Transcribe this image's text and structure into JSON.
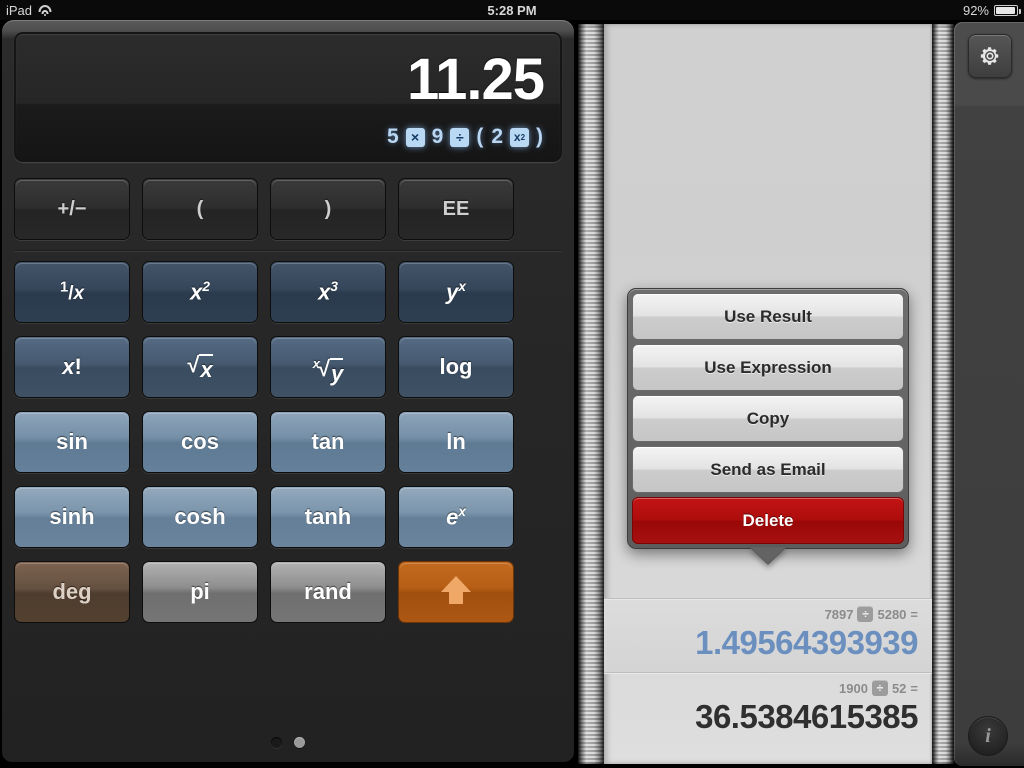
{
  "statusbar": {
    "device": "iPad",
    "wifi_icon": "wifi-icon",
    "time": "5:28 PM",
    "battery_percent": "92%",
    "battery_icon": "battery-icon"
  },
  "calculator": {
    "display": {
      "result": "11.25",
      "expression_tokens": [
        {
          "type": "num",
          "text": "5"
        },
        {
          "type": "op",
          "text": "×"
        },
        {
          "type": "num",
          "text": "9"
        },
        {
          "type": "op",
          "text": "÷"
        },
        {
          "type": "paren",
          "text": "("
        },
        {
          "type": "num",
          "text": "2"
        },
        {
          "type": "op",
          "text": "x²"
        },
        {
          "type": "paren",
          "text": ")"
        }
      ],
      "expression_plain": "5 × 9 ÷ ( 2 x² )"
    },
    "keys": [
      {
        "label": "+/−",
        "name": "key-plus-minus",
        "style": "dark"
      },
      {
        "label": "(",
        "name": "key-open-paren",
        "style": "dark"
      },
      {
        "label": ")",
        "name": "key-close-paren",
        "style": "dark"
      },
      {
        "label": "EE",
        "name": "key-ee",
        "style": "dark"
      },
      {
        "label": "1/x",
        "name": "key-reciprocal",
        "style": "blue1"
      },
      {
        "label": "x²",
        "name": "key-x-squared",
        "style": "blue1"
      },
      {
        "label": "x³",
        "name": "key-x-cubed",
        "style": "blue1"
      },
      {
        "label": "yˣ",
        "name": "key-y-to-x",
        "style": "blue1"
      },
      {
        "label": "x!",
        "name": "key-factorial",
        "style": "blue2"
      },
      {
        "label": "√x",
        "name": "key-square-root",
        "style": "blue2"
      },
      {
        "label": "ˣ√y",
        "name": "key-nth-root",
        "style": "blue2"
      },
      {
        "label": "log",
        "name": "key-log",
        "style": "blue2"
      },
      {
        "label": "sin",
        "name": "key-sin",
        "style": "blue3"
      },
      {
        "label": "cos",
        "name": "key-cos",
        "style": "blue3"
      },
      {
        "label": "tan",
        "name": "key-tan",
        "style": "blue3"
      },
      {
        "label": "ln",
        "name": "key-ln",
        "style": "blue3"
      },
      {
        "label": "sinh",
        "name": "key-sinh",
        "style": "blue4"
      },
      {
        "label": "cosh",
        "name": "key-cosh",
        "style": "blue4"
      },
      {
        "label": "tanh",
        "name": "key-tanh",
        "style": "blue4"
      },
      {
        "label": "eˣ",
        "name": "key-e-to-x",
        "style": "blue4"
      },
      {
        "label": "deg",
        "name": "key-deg",
        "style": "brown"
      },
      {
        "label": "pi",
        "name": "key-pi",
        "style": "gray"
      },
      {
        "label": "rand",
        "name": "key-rand",
        "style": "gray"
      },
      {
        "label": "",
        "name": "key-shift-up",
        "style": "orange",
        "icon": "up-arrow-icon"
      }
    ],
    "page_dots": {
      "count": 2,
      "active_index": 1
    }
  },
  "tape": {
    "rows": [
      {
        "operand_left": "7897",
        "operator": "÷",
        "operand_right": "5280",
        "equals": "=",
        "result": "1.49564393939",
        "selected": true
      },
      {
        "operand_left": "1900",
        "operator": "÷",
        "operand_right": "52",
        "equals": "=",
        "result": "36.5384615385",
        "selected": false
      }
    ]
  },
  "popover": {
    "items": [
      {
        "label": "Use Result",
        "name": "popover-use-result",
        "danger": false
      },
      {
        "label": "Use Expression",
        "name": "popover-use-expression",
        "danger": false
      },
      {
        "label": "Copy",
        "name": "popover-copy",
        "danger": false
      },
      {
        "label": "Send as Email",
        "name": "popover-send-as-email",
        "danger": false
      },
      {
        "label": "Delete",
        "name": "popover-delete",
        "danger": true
      }
    ]
  },
  "rail": {
    "gear_icon": "gear-icon",
    "info_label": "i"
  },
  "colors": {
    "accent_blue": "#6b8fbe",
    "expression_blue": "#b9d8f4",
    "delete_red": "#ae0d0d",
    "shift_orange": "#b75f17",
    "deg_brown": "#64503f"
  }
}
